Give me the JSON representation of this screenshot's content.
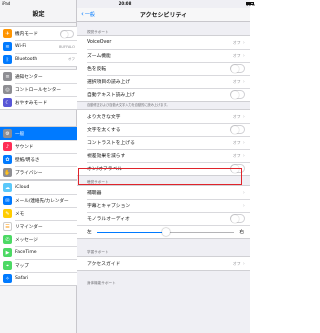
{
  "status_bar": {
    "carrier": "iPad",
    "time": "20:08",
    "battery": "50%"
  },
  "sidebar": {
    "title": "設定",
    "groups": [
      [
        {
          "label": "機内モード",
          "icon": "airplane-icon",
          "color": "#ff9500",
          "glyph": "✈",
          "accessory": "toggle",
          "value": ""
        },
        {
          "label": "Wi-Fi",
          "icon": "wifi-icon",
          "color": "#007aff",
          "glyph": "≋",
          "accessory": "value",
          "value": "BUFFALO"
        },
        {
          "label": "Bluetooth",
          "icon": "bluetooth-icon",
          "color": "#007aff",
          "glyph": "ᛒ",
          "accessory": "value",
          "value": "オフ"
        }
      ],
      [
        {
          "label": "通知センター",
          "icon": "notifications-icon",
          "color": "#8e8e93",
          "glyph": "≡",
          "accessory": "",
          "value": ""
        },
        {
          "label": "コントロールセンター",
          "icon": "control-center-icon",
          "color": "#8e8e93",
          "glyph": "◎",
          "accessory": "",
          "value": ""
        },
        {
          "label": "おやすみモード",
          "icon": "moon-icon",
          "color": "#5856d6",
          "glyph": "☾",
          "accessory": "",
          "value": ""
        }
      ],
      [
        {
          "label": "一般",
          "icon": "gear-icon",
          "color": "#8e8e93",
          "glyph": "⚙",
          "accessory": "",
          "value": "",
          "selected": true
        },
        {
          "label": "サウンド",
          "icon": "speaker-icon",
          "color": "#ff2d55",
          "glyph": "♪",
          "accessory": "",
          "value": ""
        },
        {
          "label": "壁紙/明るさ",
          "icon": "wallpaper-icon",
          "color": "#007aff",
          "glyph": "✿",
          "accessory": "",
          "value": ""
        },
        {
          "label": "プライバシー",
          "icon": "hand-icon",
          "color": "#8e8e93",
          "glyph": "✋",
          "accessory": "",
          "value": ""
        }
      ],
      [
        {
          "label": "iCloud",
          "icon": "cloud-icon",
          "color": "#5ac8fa",
          "glyph": "☁",
          "accessory": "",
          "value": ""
        },
        {
          "label": "メール/連絡先/カレンダー",
          "icon": "mail-icon",
          "color": "#007aff",
          "glyph": "✉",
          "accessory": "",
          "value": ""
        },
        {
          "label": "メモ",
          "icon": "notes-icon",
          "color": "#ffcc00",
          "glyph": "✎",
          "accessory": "",
          "value": ""
        },
        {
          "label": "リマインダー",
          "icon": "reminders-icon",
          "color": "#ffffff",
          "glyph": "☰",
          "accessory": "",
          "value": ""
        },
        {
          "label": "メッセージ",
          "icon": "messages-icon",
          "color": "#4cd964",
          "glyph": "✆",
          "accessory": "",
          "value": ""
        },
        {
          "label": "FaceTime",
          "icon": "facetime-icon",
          "color": "#4cd964",
          "glyph": "▶",
          "accessory": "",
          "value": ""
        },
        {
          "label": "マップ",
          "icon": "maps-icon",
          "color": "#4cd964",
          "glyph": "⌖",
          "accessory": "",
          "value": ""
        },
        {
          "label": "Safari",
          "icon": "compass-icon",
          "color": "#007aff",
          "glyph": "✧",
          "accessory": "",
          "value": ""
        }
      ]
    ]
  },
  "nav": {
    "back_label": "一般",
    "title": "アクセシビリティ"
  },
  "sections": {
    "vision_header": "視覚サポート",
    "vision_items": [
      {
        "label": "VoiceOver",
        "accessory": "value",
        "value": "オフ"
      },
      {
        "label": "ズーム機能",
        "accessory": "value",
        "value": "オフ"
      },
      {
        "label": "色を反転",
        "accessory": "toggle",
        "value": ""
      },
      {
        "label": "選択項目の読み上げ",
        "accessory": "value",
        "value": "オフ"
      },
      {
        "label": "自動テキスト読み上げ",
        "accessory": "toggle",
        "value": ""
      }
    ],
    "vision_footnote": "自動修正および自動大文字入力を自動的に読み上げます。",
    "display_items": [
      {
        "label": "より大きな文字",
        "accessory": "value",
        "value": "オフ"
      },
      {
        "label": "文字を太くする",
        "accessory": "toggle",
        "value": ""
      },
      {
        "label": "コントラストを上げる",
        "accessory": "value",
        "value": "オフ"
      },
      {
        "label": "視差効果を減らす",
        "accessory": "value",
        "value": "オフ"
      },
      {
        "label": "オン/オフラベル",
        "accessory": "toggle",
        "value": ""
      }
    ],
    "hearing_header": "聴覚サポート",
    "hearing_items": [
      {
        "label": "補聴器",
        "accessory": "chevron",
        "value": ""
      },
      {
        "label": "字幕とキャプション",
        "accessory": "chevron",
        "value": ""
      },
      {
        "label": "モノラルオーディオ",
        "accessory": "toggle",
        "value": ""
      }
    ],
    "balance": {
      "left_label": "左",
      "right_label": "右",
      "value": 0.5
    },
    "learning_header": "学習サポート",
    "learning_items": [
      {
        "label": "アクセスガイド",
        "accessory": "value",
        "value": "オフ"
      }
    ],
    "physical_header": "身体機能サポート"
  },
  "highlight_color": "#e0242b"
}
